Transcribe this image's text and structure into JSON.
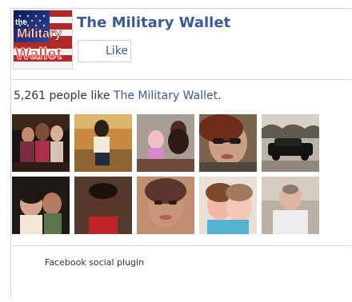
{
  "plugin": {
    "page_name": "The Military Wallet",
    "like_button_label": "Like",
    "like_count_text": "5,261 people like ",
    "like_count_link": "The Military Wallet",
    "like_count_end": ".",
    "footer": "Facebook social plugin",
    "logo": {
      "line1": "the",
      "line2": "Military",
      "line3": "Wallet"
    }
  },
  "colors": {
    "link": "#3b5998",
    "border": "#cfd3db",
    "text": "#333333"
  },
  "faces": [
    {
      "name": "face-1"
    },
    {
      "name": "face-2"
    },
    {
      "name": "face-3"
    },
    {
      "name": "face-4"
    },
    {
      "name": "face-5"
    },
    {
      "name": "face-6"
    },
    {
      "name": "face-7"
    },
    {
      "name": "face-8"
    },
    {
      "name": "face-9"
    },
    {
      "name": "face-10"
    }
  ]
}
